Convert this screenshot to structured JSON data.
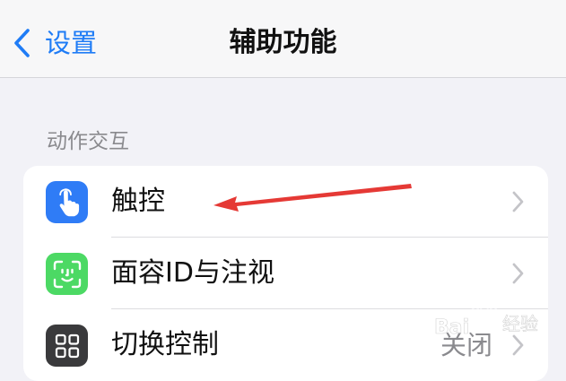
{
  "navbar": {
    "back_label": "设置",
    "title": "辅助功能"
  },
  "section": {
    "header": "动作交互"
  },
  "rows": [
    {
      "label": "触控",
      "value": "",
      "icon": "hand-touch-icon",
      "icon_bg": "#2f7cf6"
    },
    {
      "label": "面容ID与注视",
      "value": "",
      "icon": "face-id-icon",
      "icon_bg": "#4cd964"
    },
    {
      "label": "切换控制",
      "value": "关闭",
      "icon": "switch-control-icon",
      "icon_bg": "#3a3a3c"
    }
  ],
  "watermark": {
    "text": "Bai 经验"
  },
  "colors": {
    "accent": "#1f7cf6",
    "annotation": "#e53935"
  }
}
